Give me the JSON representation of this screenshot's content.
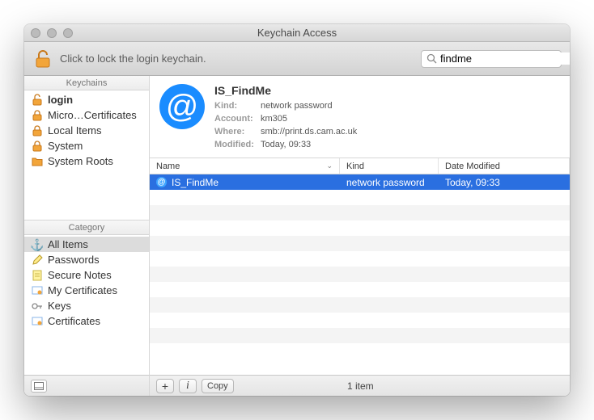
{
  "window_title": "Keychain Access",
  "toolbar": {
    "lock_text": "Click to lock the login keychain."
  },
  "search": {
    "icon": "search",
    "value": "findme",
    "placeholder": "Search"
  },
  "sidebar": {
    "keychains_header": "Keychains",
    "keychains": [
      {
        "label": "login",
        "icon": "padlock-open",
        "bold": true
      },
      {
        "label": "Micro…Certificates",
        "icon": "padlock"
      },
      {
        "label": "Local Items",
        "icon": "padlock"
      },
      {
        "label": "System",
        "icon": "padlock"
      },
      {
        "label": "System Roots",
        "icon": "folder"
      }
    ],
    "category_header": "Category",
    "categories": [
      {
        "label": "All Items",
        "icon": "anchor",
        "selected": true
      },
      {
        "label": "Passwords",
        "icon": "pen"
      },
      {
        "label": "Secure Notes",
        "icon": "note"
      },
      {
        "label": "My Certificates",
        "icon": "cert"
      },
      {
        "label": "Keys",
        "icon": "key"
      },
      {
        "label": "Certificates",
        "icon": "cert"
      }
    ]
  },
  "detail": {
    "title": "IS_FindMe",
    "rows": [
      {
        "k": "Kind:",
        "v": "network password"
      },
      {
        "k": "Account:",
        "v": "km305"
      },
      {
        "k": "Where:",
        "v": "smb://print.ds.cam.ac.uk"
      },
      {
        "k": "Modified:",
        "v": "Today, 09:33"
      }
    ]
  },
  "table": {
    "columns": {
      "name": "Name",
      "kind": "Kind",
      "date": "Date Modified"
    },
    "rows": [
      {
        "name": "IS_FindMe",
        "kind": "network password",
        "date": "Today, 09:33",
        "selected": true
      }
    ]
  },
  "footer": {
    "copy_label": "Copy",
    "count": "1 item"
  }
}
